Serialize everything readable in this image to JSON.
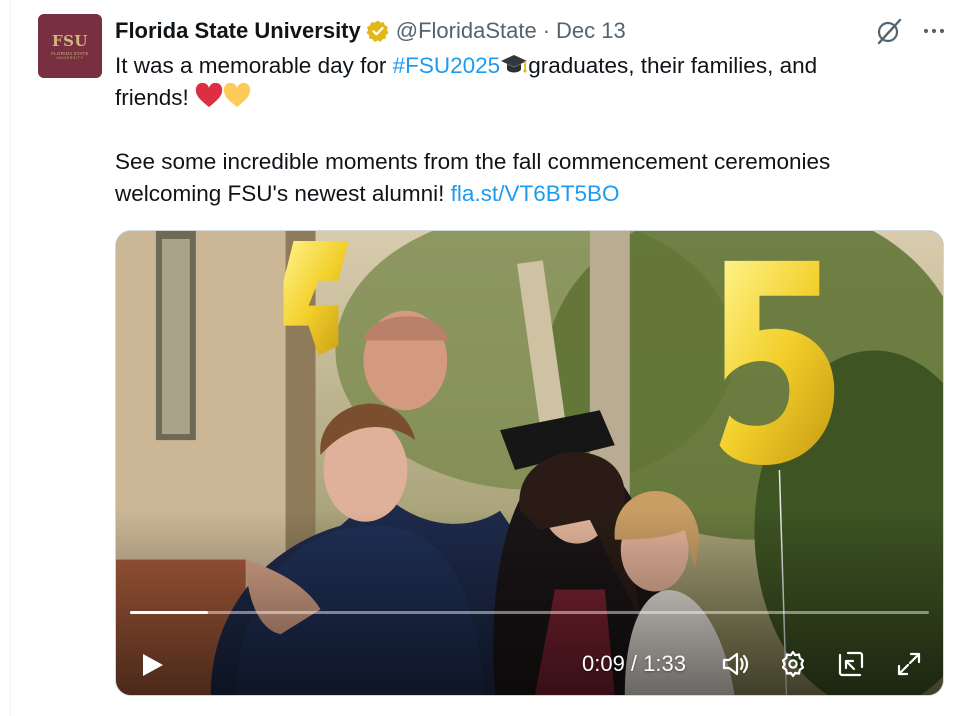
{
  "account": {
    "name": "Florida State University",
    "handle": "@FloridaState",
    "separator": "·",
    "date": "Dec 13",
    "avatar_text": "FSU",
    "avatar_subtext": "FLORIDA STATE",
    "avatar_subtext2": "UNIVERSITY"
  },
  "tweet": {
    "line1_prefix": "It was a memorable day for ",
    "hashtag": "#FSU2025",
    "line1_suffix": "graduates, their families, and",
    "line2": "friends! ",
    "line3": "See some incredible moments from the fall commencement ceremonies",
    "line4_prefix": "welcoming FSU's newest alumni! ",
    "link": "fla.st/VT6BT5BO"
  },
  "video": {
    "time_display": "0:09 / 1:33",
    "progress": 0.098
  },
  "icons": {
    "verified": "verified-badge-icon",
    "grok": "grok-icon",
    "more": "more-icon",
    "play": "play-icon",
    "volume": "volume-icon",
    "settings": "settings-icon",
    "popout": "popout-icon",
    "fullscreen": "fullscreen-icon"
  },
  "colors": {
    "link": "#1d9bf0",
    "verified_gold": "#e2b719",
    "fsu_garnet": "#782f40",
    "fsu_gold": "#cdb87d"
  }
}
